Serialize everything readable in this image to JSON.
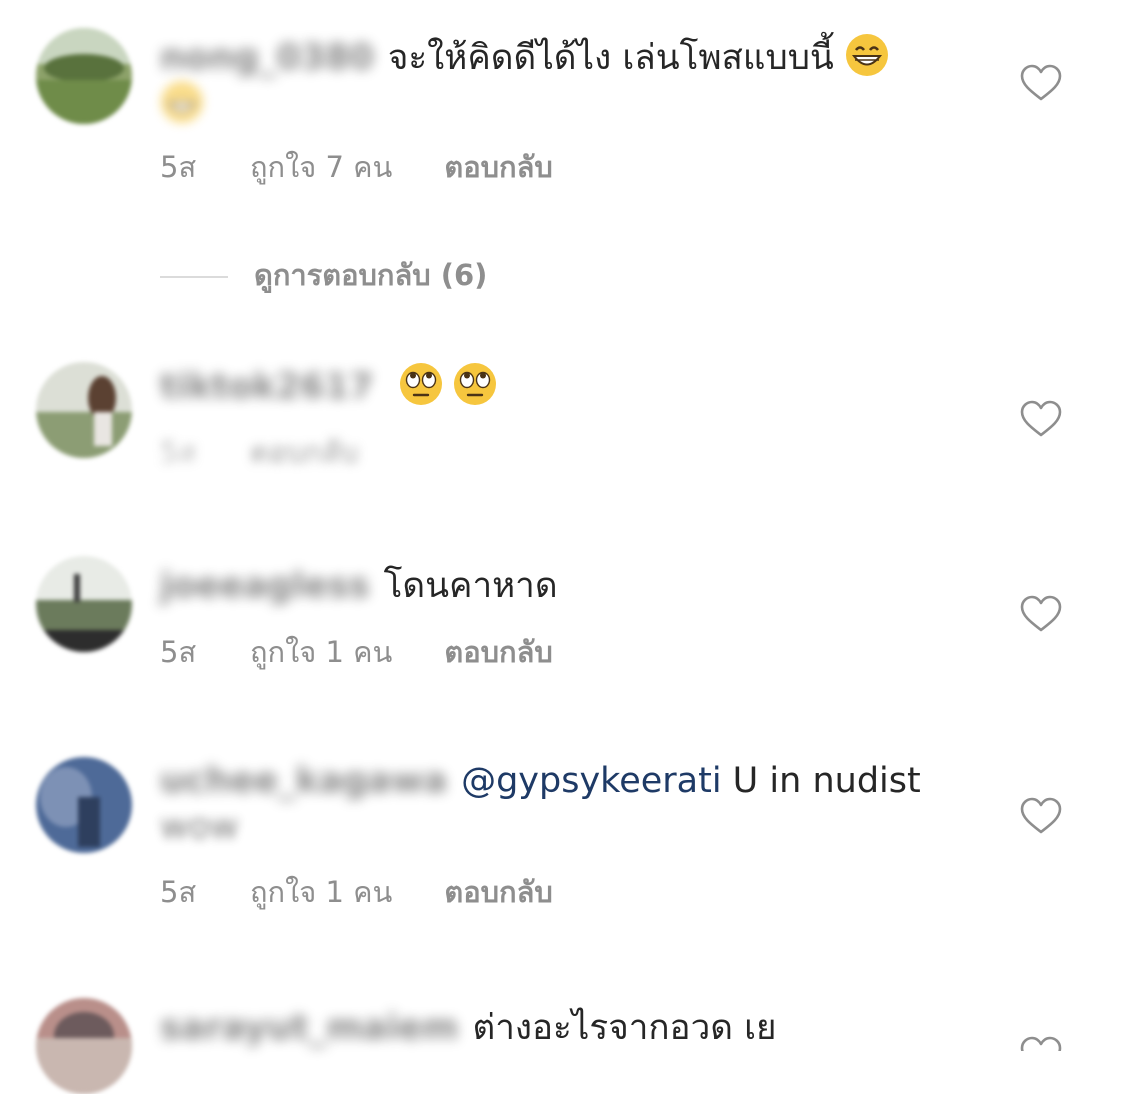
{
  "comments": [
    {
      "username": "nong_0380",
      "text": "จะให้คิดดีได้ไง เล่นโพสแบบนี้",
      "emojis": [
        "grinning-face"
      ],
      "time": "5ส",
      "likes": "ถูกใจ 7 คน",
      "reply": "ตอบกลับ"
    },
    {
      "username": "tiktok2617",
      "emojis": [
        "face-with-rolling-eyes",
        "face-with-rolling-eyes"
      ],
      "time": "5ส",
      "reply": "ตอบกลับ"
    },
    {
      "username": "joeeagless",
      "text": "โดนคาหาด",
      "time": "5ส",
      "likes": "ถูกใจ 1 คน",
      "reply": "ตอบกลับ"
    },
    {
      "username": "uchee_kagawa",
      "mention": "@gypsykeerati",
      "text": " U in nudist",
      "subtext": "wow",
      "time": "5ส",
      "likes": "ถูกใจ 1 คน",
      "reply": "ตอบกลับ"
    },
    {
      "username": "sarayut_maiem",
      "text": "ต่างอะไรจากอวด เย"
    }
  ],
  "view_replies": "ดูการตอบกลับ (6)",
  "colors": {
    "text": "#262626",
    "meta": "#8e8e8e",
    "mention": "#1e3a66",
    "divider": "#dbdbdb"
  }
}
